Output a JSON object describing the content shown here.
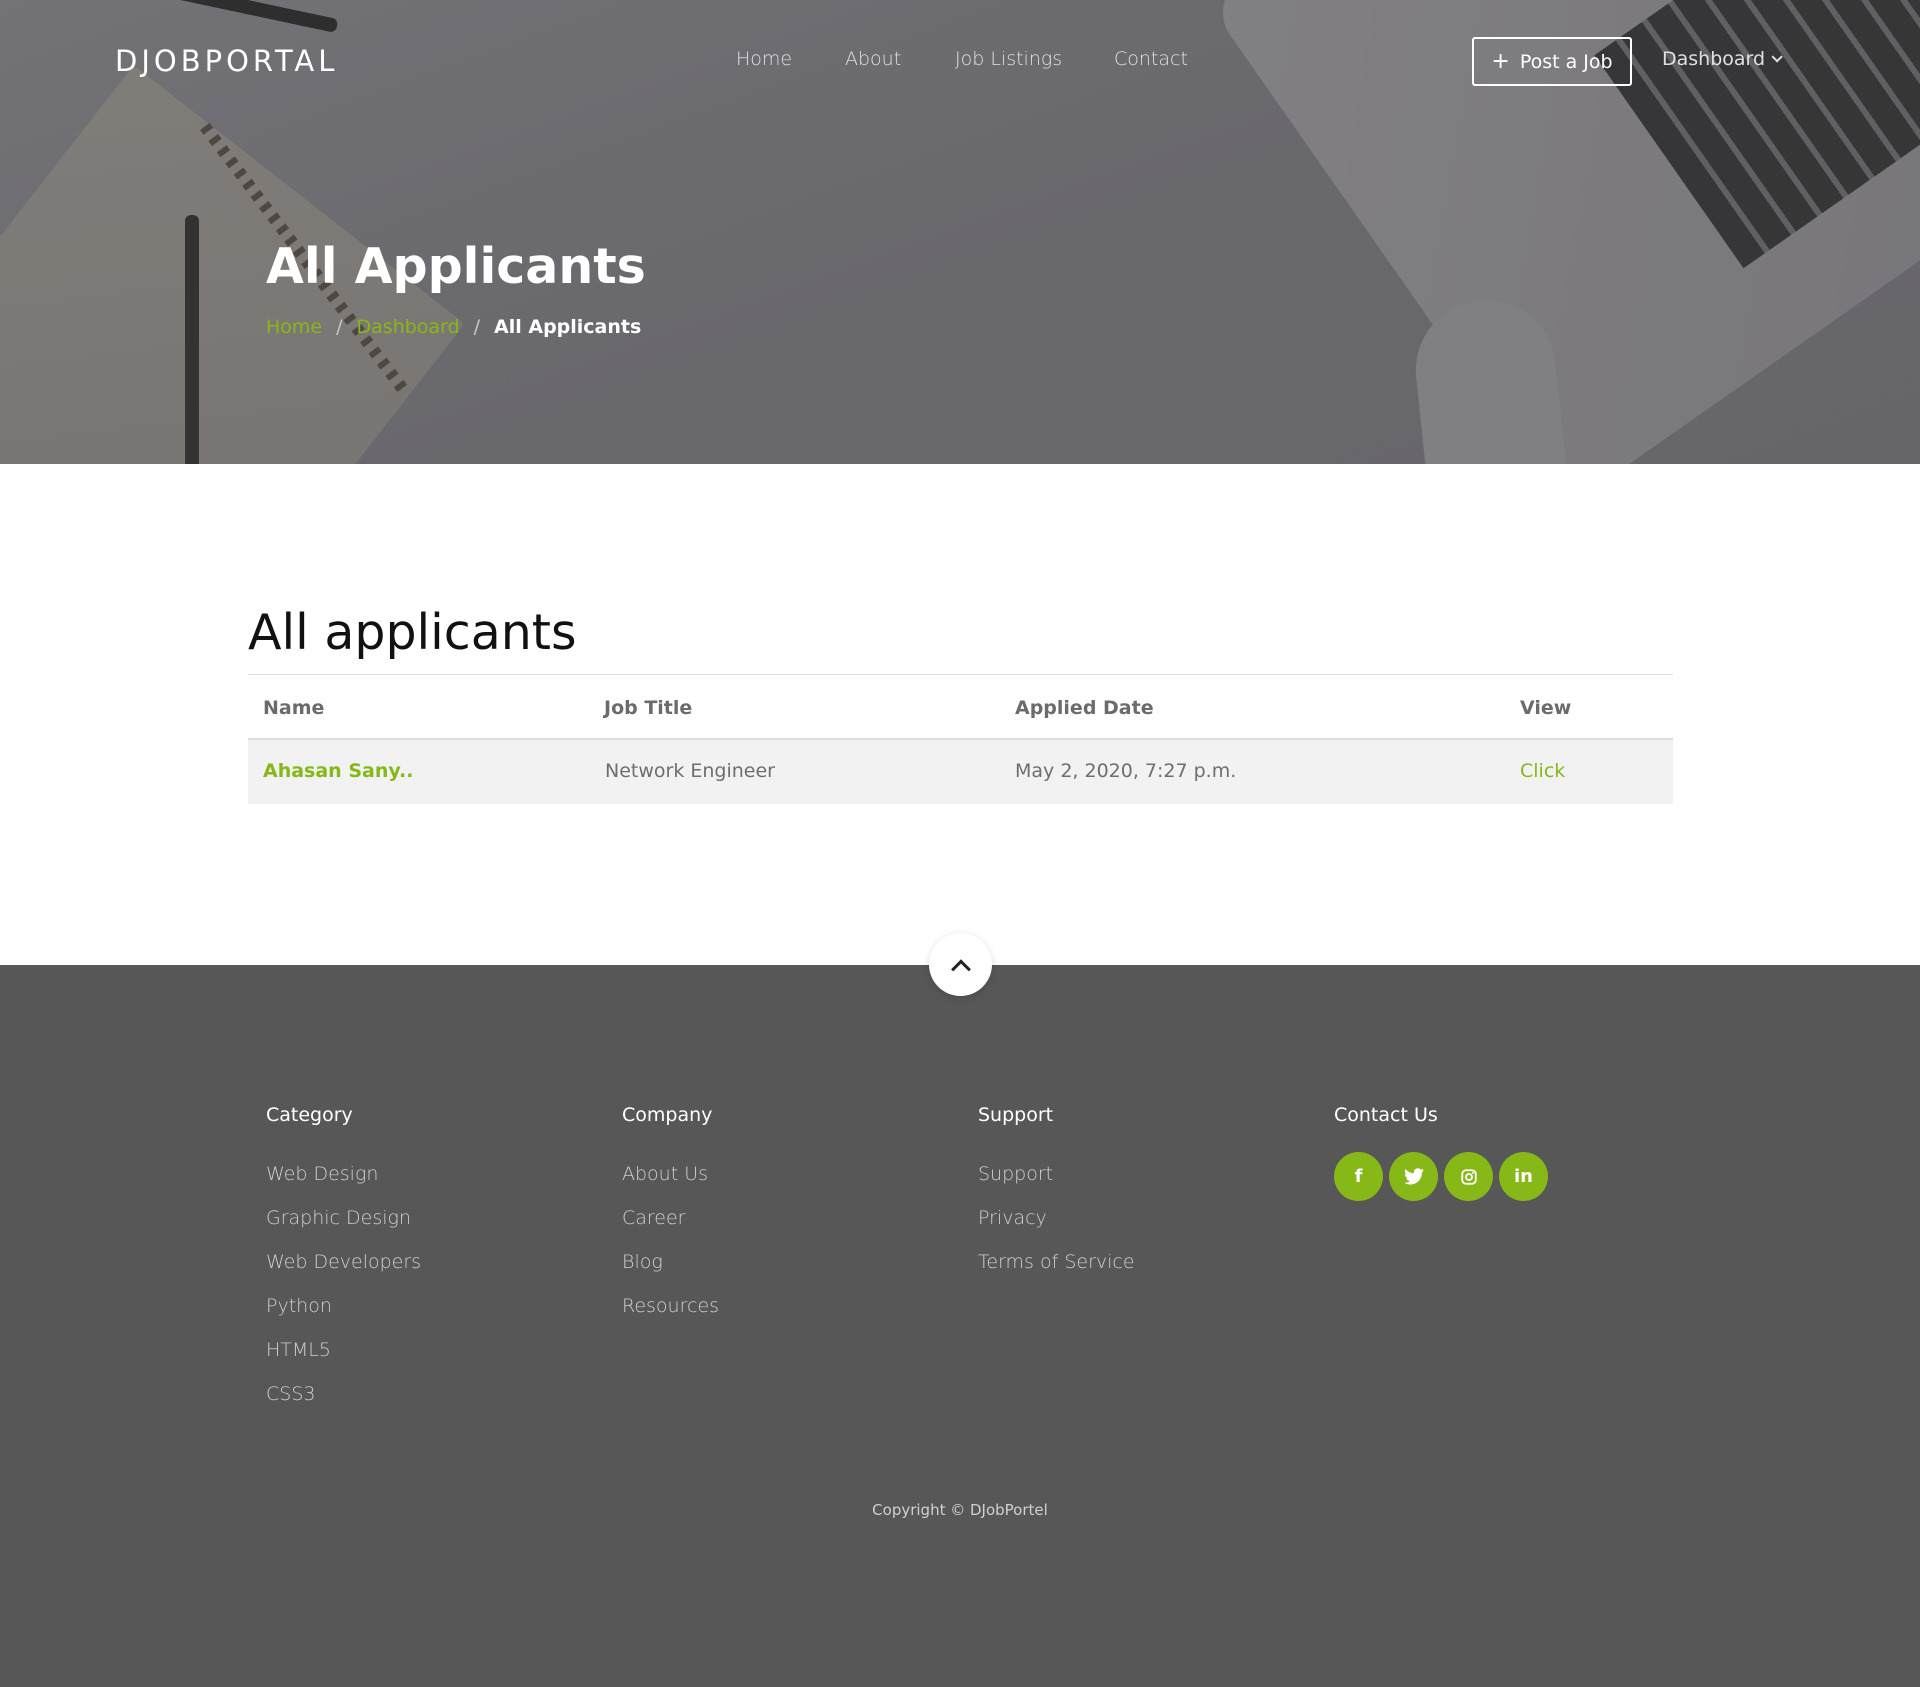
{
  "brand": {
    "logo": "DJOBPORTAL",
    "accent": "#86b817"
  },
  "nav": {
    "items": [
      "Home",
      "About",
      "Job Listings",
      "Contact"
    ],
    "post_job": "Post a Job",
    "dashboard": "Dashboard"
  },
  "hero": {
    "title": "All Applicants",
    "breadcrumb": [
      "Home",
      "Dashboard",
      "All Applicants"
    ]
  },
  "section": {
    "title": "All applicants"
  },
  "table": {
    "columns": [
      "Name",
      "Job Title",
      "Applied Date",
      "View"
    ],
    "rows": [
      {
        "name": "Ahasan Sany..",
        "job_title": "Network Engineer",
        "applied_date": "May 2, 2020, 7:27 p.m.",
        "view": "Click"
      }
    ]
  },
  "footer": {
    "category": {
      "title": "Category",
      "links": [
        "Web Design",
        "Graphic Design",
        "Web Developers",
        "Python",
        "HTML5",
        "CSS3"
      ]
    },
    "company": {
      "title": "Company",
      "links": [
        "About Us",
        "Career",
        "Blog",
        "Resources"
      ]
    },
    "support": {
      "title": "Support",
      "links": [
        "Support",
        "Privacy",
        "Terms of Service"
      ]
    },
    "contact": {
      "title": "Contact Us",
      "socials": [
        "facebook-icon",
        "twitter-icon",
        "instagram-icon",
        "linkedin-icon"
      ]
    },
    "copyright": "Copyright © DJobPortel"
  }
}
